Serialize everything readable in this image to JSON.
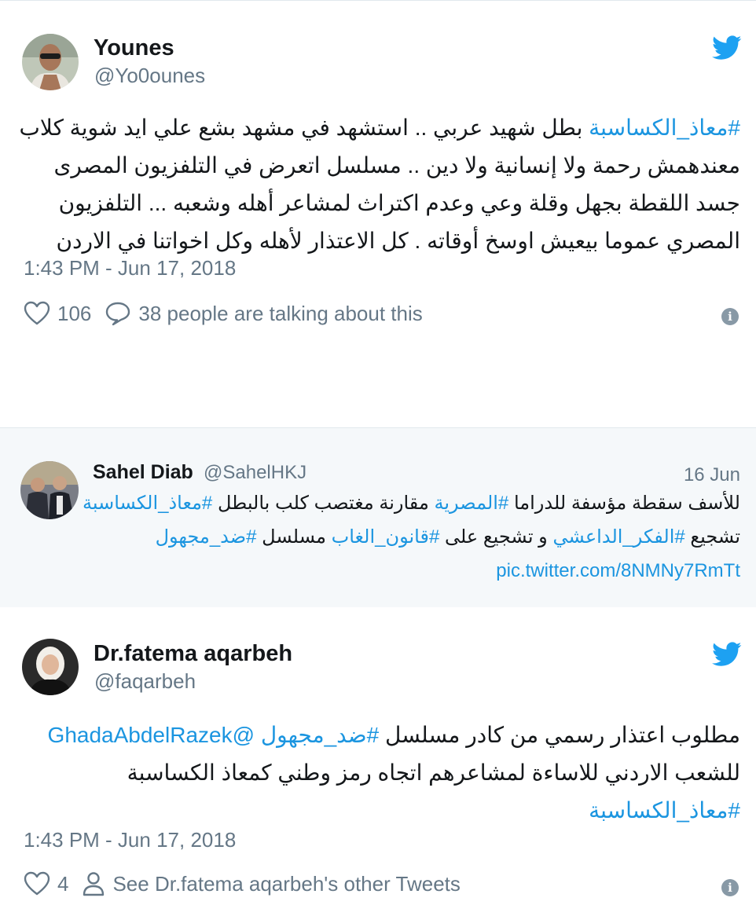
{
  "tweet1": {
    "name": "Younes",
    "handle": "@Yo0ounes",
    "text_lines": [
      [
        {
          "t": "#معاذ_الكساسبة",
          "h": true
        },
        {
          "t": " بطل شهيد عربي .. استشهد في مشهد بشع علي ايد شوية كلاب",
          "h": false
        }
      ],
      [
        {
          "t": "معندهمش رحمة ولا إنسانية ولا دين .. مسلسل اتعرض في التلفزيون المصرى",
          "h": false
        }
      ],
      [
        {
          "t": "جسد اللقطة بجهل وقلة وعي وعدم اكتراث لمشاعر أهله وشعبه ... التلفزيون",
          "h": false
        }
      ],
      [
        {
          "t": "المصري عموما بيعيش اوسخ أوقاته . كل الاعتذار لأهله وكل اخواتنا في الاردن",
          "h": false
        }
      ]
    ],
    "timestamp": "1:43 PM - Jun 17, 2018",
    "likes": "106",
    "talking": "38 people are talking about this",
    "info_glyph": "i",
    "icons": {
      "like": "heart-icon",
      "reply": "comment-icon",
      "brand": "twitter-bird-icon",
      "info": "info-icon"
    }
  },
  "quoted": {
    "name": "Sahel Diab",
    "handle": "@SahelHKJ",
    "date": "16 Jun",
    "text_lines": [
      [
        {
          "t": "للأسف سقطة مؤسفة للدراما ",
          "h": false
        },
        {
          "t": "#المصرية",
          "h": true
        },
        {
          "t": " مقارنة مغتصب كلب بالبطل ",
          "h": false
        },
        {
          "t": "#معاذ_الكساسبة",
          "h": true
        }
      ],
      [
        {
          "t": "تشجيع ",
          "h": false
        },
        {
          "t": "#الفكر_الداعشي",
          "h": true
        },
        {
          "t": " و تشجيع على ",
          "h": false
        },
        {
          "t": "#قانون_الغاب",
          "h": true
        },
        {
          "t": " مسلسل ",
          "h": false
        },
        {
          "t": "#ضد_مجهول",
          "h": true
        }
      ]
    ],
    "link": "pic.twitter.com/8NMNy7RmTt"
  },
  "tweet2": {
    "name": "Dr.fatema aqarbeh",
    "handle": "@faqarbeh",
    "text_lines": [
      [
        {
          "t": "مطلوب اعتذار رسمي من كادر مسلسل ",
          "h": false
        },
        {
          "t": "#ضد_مجهول",
          "h": true
        },
        {
          "t": " ",
          "h": false
        },
        {
          "t": "@GhadaAbdelRazek",
          "h": true
        }
      ],
      [
        {
          "t": "للشعب الاردني للاساءة لمشاعرهم اتجاه رمز وطني كمعاذ الكساسبة",
          "h": false
        }
      ],
      [
        {
          "t": "#معاذ_الكساسبة",
          "h": true
        }
      ]
    ],
    "timestamp": "1:43 PM - Jun 17, 2018",
    "likes": "4",
    "other_tweets": "See Dr.fatema aqarbeh's other Tweets",
    "info_glyph": "i",
    "icons": {
      "like": "heart-icon",
      "profile": "person-icon",
      "brand": "twitter-bird-icon",
      "info": "info-icon"
    }
  },
  "colors": {
    "link": "#1b95e0",
    "muted": "#657786",
    "bird": "#1da1f2",
    "quote_bg": "#f5f8fa"
  }
}
